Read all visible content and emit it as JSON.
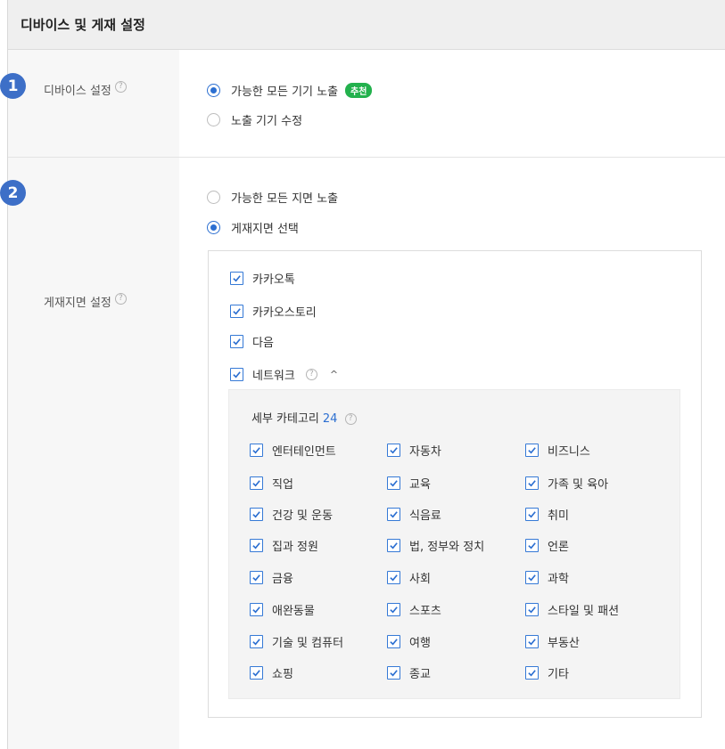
{
  "header": {
    "title": "디바이스 및 게재 설정"
  },
  "steps": [
    "1",
    "2"
  ],
  "device": {
    "label": "디바이스 설정",
    "help": "?",
    "options": [
      {
        "label": "가능한 모든 기기 노출",
        "checked": true,
        "badge": "추천"
      },
      {
        "label": "노출 기기 수정",
        "checked": false
      }
    ]
  },
  "placement": {
    "label": "게재지면 설정",
    "help": "?",
    "options": [
      {
        "label": "가능한 모든 지면 노출",
        "checked": false
      },
      {
        "label": "게재지면 선택",
        "checked": true
      }
    ],
    "media": [
      {
        "label": "카카오톡",
        "checked": true
      },
      {
        "label": "카카오스토리",
        "checked": true
      },
      {
        "label": "다음",
        "checked": true
      },
      {
        "label": "네트워크",
        "checked": true,
        "help": "?",
        "toggle": "^"
      }
    ],
    "sub": {
      "title": "세부 카테고리",
      "count": "24",
      "help": "?",
      "categories": [
        [
          "엔터테인먼트",
          "자동차",
          "비즈니스"
        ],
        [
          "직업",
          "교육",
          "가족 및 육아"
        ],
        [
          "건강 및 운동",
          "식음료",
          "취미"
        ],
        [
          "집과 정원",
          "법, 정부와 정치",
          "언론"
        ],
        [
          "금융",
          "사회",
          "과학"
        ],
        [
          "애완동물",
          "스포츠",
          "스타일 및 패션"
        ],
        [
          "기술 및 컴퓨터",
          "여행",
          "부동산"
        ],
        [
          "쇼핑",
          "종교",
          "기타"
        ]
      ]
    }
  },
  "colors": {
    "accent": "#2c6fd1",
    "step": "#3d6fc7",
    "recommend": "#23b14d"
  }
}
